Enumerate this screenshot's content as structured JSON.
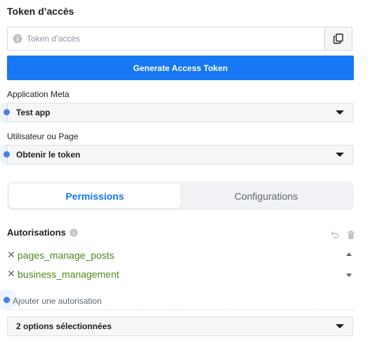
{
  "token_section": {
    "title": "Token d’accès",
    "input_placeholder": "Token d’accès",
    "input_value": "",
    "generate_label": "Generate Access Token"
  },
  "application": {
    "label": "Application Meta",
    "selected": "Test app"
  },
  "user_page": {
    "label": "Utilisateur ou Page",
    "selected": "Obtenir le token"
  },
  "tabs": [
    {
      "label": "Permissions",
      "active": true
    },
    {
      "label": "Configurations",
      "active": false
    }
  ],
  "autorisations": {
    "title": "Autorisations",
    "items": [
      {
        "name": "pages_manage_posts"
      },
      {
        "name": "business_management"
      }
    ],
    "add_label": "Ajouter une autorisation",
    "options_selected": "2 options sélectionnées"
  },
  "colors": {
    "accent": "#1877f2",
    "permission_text": "#4b8a1c",
    "indicator_dot": "#4a7fe8"
  },
  "icons": [
    "info-icon",
    "copy-icon",
    "chevron-down-icon",
    "undo-icon",
    "trash-icon",
    "close-icon",
    "sort-up-icon",
    "sort-down-icon"
  ]
}
